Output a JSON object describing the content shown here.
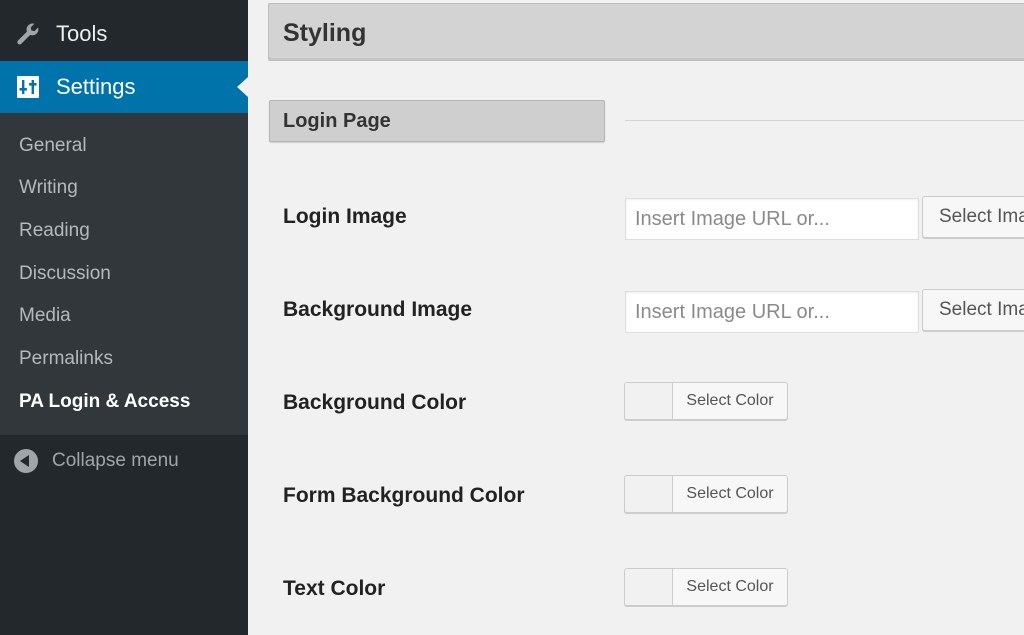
{
  "sidebar": {
    "tools_label": "Tools",
    "tools_icon": "wrench-icon",
    "settings_label": "Settings",
    "settings_icon": "settings-icon",
    "submenu": [
      {
        "label": "General"
      },
      {
        "label": "Writing"
      },
      {
        "label": "Reading"
      },
      {
        "label": "Discussion"
      },
      {
        "label": "Media"
      },
      {
        "label": "Permalinks"
      },
      {
        "label": "PA Login & Access",
        "current": true
      }
    ],
    "collapse_label": "Collapse menu",
    "colors": {
      "bg": "#23282d",
      "submenu_bg": "#32373c",
      "active": "#0073aa"
    }
  },
  "main": {
    "section_title": "Styling",
    "subsection_title": "Login Page",
    "fields": {
      "login_image": {
        "label": "Login Image",
        "placeholder": "Insert Image URL or...",
        "value": "",
        "button": "Select Image"
      },
      "background_image": {
        "label": "Background Image",
        "placeholder": "Insert Image URL or...",
        "value": "",
        "button": "Select Image"
      },
      "background_color": {
        "label": "Background Color",
        "button": "Select Color"
      },
      "form_background_color": {
        "label": "Form Background Color",
        "button": "Select Color"
      },
      "text_color": {
        "label": "Text Color",
        "button": "Select Color"
      }
    }
  }
}
